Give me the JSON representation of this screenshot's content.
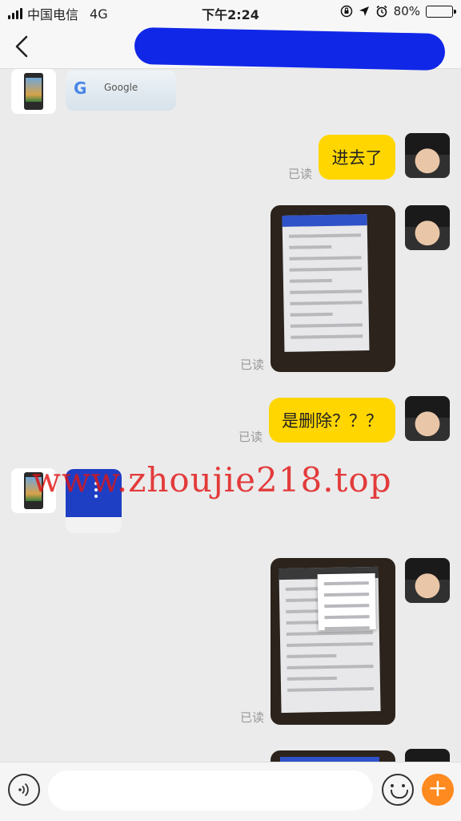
{
  "status_bar": {
    "carrier": "中国电信",
    "network": "4G",
    "time": "下午2:24",
    "battery": "80%",
    "battery_level": 0.8
  },
  "nav": {
    "title": "",
    "redaction_color": "#1027e8"
  },
  "messages": {
    "m1_google_text": "Google",
    "m1_google_letter": "G",
    "m2_text": "进去了",
    "m2_status": "已读",
    "m3_status": "已读",
    "m4_text": "是删除？？？",
    "m4_status": "已读",
    "m6_status": "已读"
  },
  "watermark": "www.zhoujie218.top",
  "input": {
    "placeholder": "",
    "value": ""
  },
  "colors": {
    "bubble": "#ffd600",
    "background": "#ebebeb",
    "plus_button": "#ff8a1f",
    "watermark": "#e11414"
  }
}
